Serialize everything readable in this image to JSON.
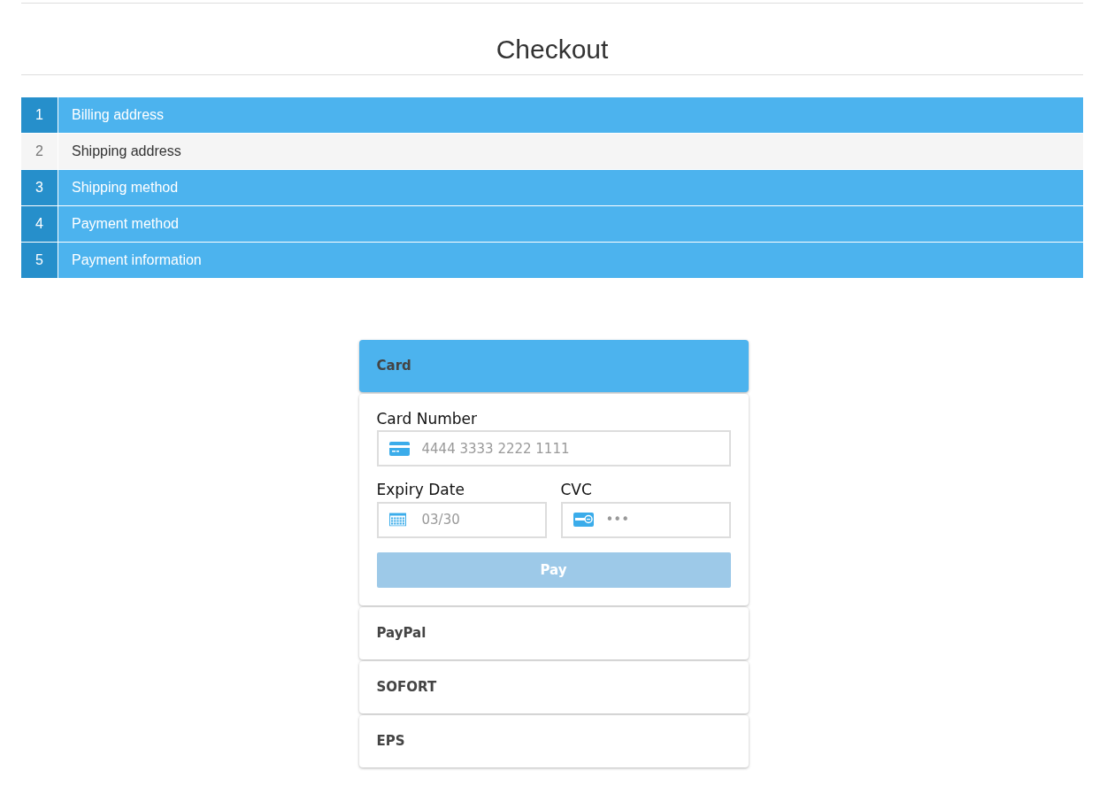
{
  "page": {
    "title": "Checkout"
  },
  "steps": [
    {
      "number": "1",
      "label": "Billing address",
      "selected": false
    },
    {
      "number": "2",
      "label": "Shipping address",
      "selected": true
    },
    {
      "number": "3",
      "label": "Shipping method",
      "selected": false
    },
    {
      "number": "4",
      "label": "Payment method",
      "selected": false
    },
    {
      "number": "5",
      "label": "Payment information",
      "selected": false
    }
  ],
  "payment_methods": [
    {
      "label": "Card",
      "selected": true,
      "expanded": true
    },
    {
      "label": "PayPal",
      "selected": false,
      "expanded": false
    },
    {
      "label": "SOFORT",
      "selected": false,
      "expanded": false
    },
    {
      "label": "EPS",
      "selected": false,
      "expanded": false
    }
  ],
  "card_form": {
    "card_number": {
      "label": "Card Number",
      "placeholder": "4444 3333 2222 1111"
    },
    "expiry": {
      "label": "Expiry Date",
      "placeholder": "03/30"
    },
    "cvc": {
      "label": "CVC",
      "placeholder": "•••"
    },
    "pay_button": {
      "label": "Pay",
      "disabled": true
    }
  }
}
